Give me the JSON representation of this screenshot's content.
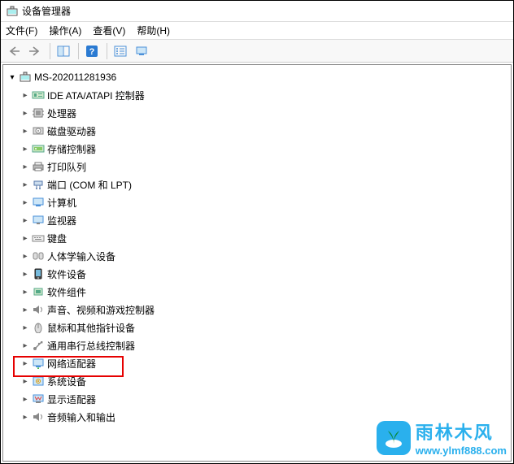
{
  "window": {
    "title": "设备管理器"
  },
  "menu": {
    "file": "文件(F)",
    "action": "操作(A)",
    "view": "查看(V)",
    "help": "帮助(H)"
  },
  "toolbar": {
    "back_icon": "back-arrow-icon",
    "forward_icon": "forward-arrow-icon",
    "details_icon": "details-pane-icon",
    "help_icon": "help-icon",
    "list_icon": "icon-list-icon",
    "monitor_icon": "monitor-icon"
  },
  "tree": {
    "root": {
      "label": "MS-202011281936",
      "expanded": true
    },
    "items": [
      {
        "label": "IDE ATA/ATAPI 控制器",
        "icon": "ide-controller-icon"
      },
      {
        "label": "处理器",
        "icon": "cpu-icon"
      },
      {
        "label": "磁盘驱动器",
        "icon": "disk-drive-icon"
      },
      {
        "label": "存储控制器",
        "icon": "storage-controller-icon"
      },
      {
        "label": "打印队列",
        "icon": "printer-icon"
      },
      {
        "label": "端口 (COM 和 LPT)",
        "icon": "ports-icon"
      },
      {
        "label": "计算机",
        "icon": "computer-icon"
      },
      {
        "label": "监视器",
        "icon": "monitor-icon"
      },
      {
        "label": "键盘",
        "icon": "keyboard-icon"
      },
      {
        "label": "人体学输入设备",
        "icon": "hid-icon"
      },
      {
        "label": "软件设备",
        "icon": "software-device-icon"
      },
      {
        "label": "软件组件",
        "icon": "software-component-icon"
      },
      {
        "label": "声音、视频和游戏控制器",
        "icon": "sound-icon"
      },
      {
        "label": "鼠标和其他指针设备",
        "icon": "mouse-icon"
      },
      {
        "label": "通用串行总线控制器",
        "icon": "usb-controller-icon"
      },
      {
        "label": "网络适配器",
        "icon": "network-adapter-icon",
        "highlighted": true
      },
      {
        "label": "系统设备",
        "icon": "system-device-icon"
      },
      {
        "label": "显示适配器",
        "icon": "display-adapter-icon"
      },
      {
        "label": "音频输入和输出",
        "icon": "audio-io-icon"
      }
    ]
  },
  "watermark": {
    "brand_cn": "雨林木风",
    "url": "www.ylmf888.com"
  }
}
